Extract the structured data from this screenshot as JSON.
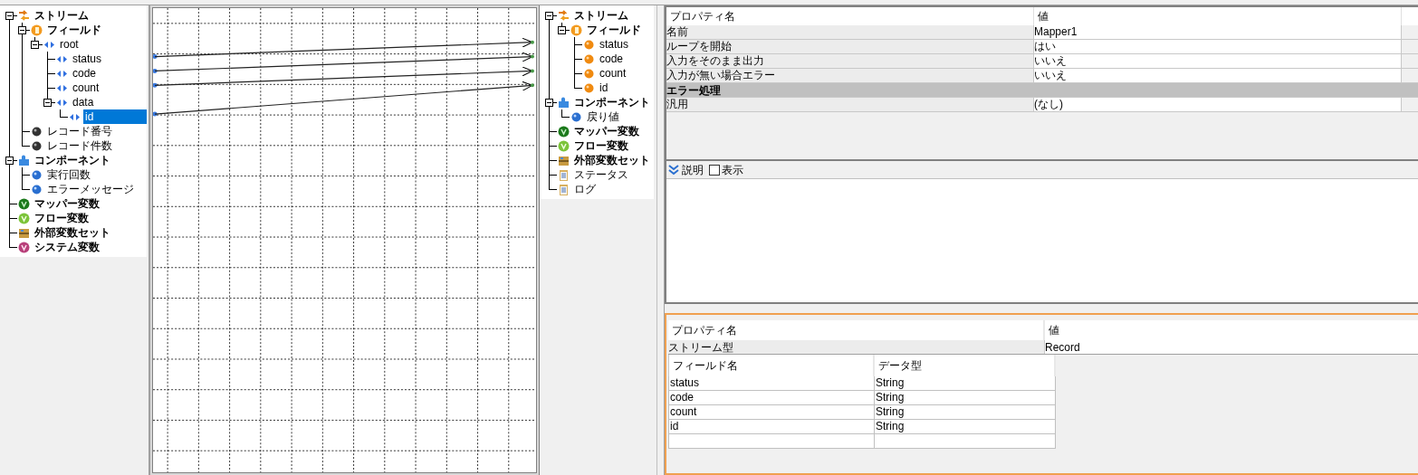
{
  "source_tree": [
    {
      "label": "ストリーム",
      "kind": "stream",
      "bold": true,
      "expanded": true,
      "selected": false,
      "children": [
        {
          "label": "フィールド",
          "kind": "field",
          "bold": true,
          "expanded": true,
          "selected": false,
          "children": [
            {
              "label": "root",
              "kind": "element",
              "bold": false,
              "expanded": true,
              "selected": false,
              "children": [
                {
                  "label": "status",
                  "kind": "element",
                  "bold": false,
                  "selected": false
                },
                {
                  "label": "code",
                  "kind": "element",
                  "bold": false,
                  "selected": false
                },
                {
                  "label": "count",
                  "kind": "element",
                  "bold": false,
                  "selected": false
                },
                {
                  "label": "data",
                  "kind": "element",
                  "bold": false,
                  "expanded": true,
                  "selected": false,
                  "children": [
                    {
                      "label": "id",
                      "kind": "element",
                      "bold": false,
                      "selected": true
                    }
                  ]
                }
              ]
            }
          ]
        },
        {
          "label": "レコード番号",
          "kind": "record",
          "bold": false,
          "selected": false
        },
        {
          "label": "レコード件数",
          "kind": "record",
          "bold": false,
          "selected": false
        }
      ]
    },
    {
      "label": "コンポーネント",
      "kind": "component",
      "bold": true,
      "expanded": true,
      "selected": false,
      "children": [
        {
          "label": "実行回数",
          "kind": "value",
          "bold": false,
          "selected": false
        },
        {
          "label": "エラーメッセージ",
          "kind": "value",
          "bold": false,
          "selected": false
        }
      ]
    },
    {
      "label": "マッパー変数",
      "kind": "mapper",
      "bold": true,
      "selected": false
    },
    {
      "label": "フロー変数",
      "kind": "flow",
      "bold": true,
      "selected": false
    },
    {
      "label": "外部変数セット",
      "kind": "external",
      "bold": true,
      "selected": false
    },
    {
      "label": "システム変数",
      "kind": "system",
      "bold": true,
      "selected": false
    }
  ],
  "target_tree": [
    {
      "label": "ストリーム",
      "kind": "stream",
      "bold": true,
      "expanded": true,
      "selected": false,
      "children": [
        {
          "label": "フィールド",
          "kind": "field",
          "bold": true,
          "expanded": true,
          "selected": false,
          "children": [
            {
              "label": "status",
              "kind": "ball",
              "bold": false,
              "selected": false
            },
            {
              "label": "code",
              "kind": "ball",
              "bold": false,
              "selected": false
            },
            {
              "label": "count",
              "kind": "ball",
              "bold": false,
              "selected": false
            },
            {
              "label": "id",
              "kind": "ball",
              "bold": false,
              "selected": false
            }
          ]
        }
      ]
    },
    {
      "label": "コンポーネント",
      "kind": "component",
      "bold": true,
      "expanded": true,
      "selected": false,
      "children": [
        {
          "label": "戻り値",
          "kind": "value",
          "bold": false,
          "selected": false
        }
      ]
    },
    {
      "label": "マッパー変数",
      "kind": "mapper",
      "bold": true,
      "selected": false
    },
    {
      "label": "フロー変数",
      "kind": "flow",
      "bold": true,
      "selected": false
    },
    {
      "label": "外部変数セット",
      "kind": "external",
      "bold": true,
      "selected": false
    },
    {
      "label": "ステータス",
      "kind": "clipboard",
      "bold": false,
      "selected": false
    },
    {
      "label": "ログ",
      "kind": "clipboard",
      "bold": false,
      "selected": false
    }
  ],
  "properties": {
    "columns": [
      "プロパティ名",
      "値"
    ],
    "rows": [
      {
        "kind": "property",
        "name": "名前",
        "value": "Mapper1"
      },
      {
        "kind": "property",
        "name": "ループを開始",
        "value": "はい"
      },
      {
        "kind": "property",
        "name": "入力をそのまま出力",
        "value": "いいえ"
      },
      {
        "kind": "property",
        "name": "入力が無い場合エラー",
        "value": "いいえ"
      },
      {
        "kind": "section",
        "name": "エラー処理"
      },
      {
        "kind": "property",
        "name": "汎用",
        "value": "(なし)"
      }
    ]
  },
  "description_bar": {
    "label": "説明",
    "show_checkbox": {
      "label": "表示",
      "checked": false
    }
  },
  "stream_properties": {
    "columns": [
      "プロパティ名",
      "値"
    ],
    "rows": [
      {
        "name": "ストリーム型",
        "value": "Record"
      }
    ],
    "field_table": {
      "columns": [
        "フィールド名",
        "データ型"
      ],
      "rows": [
        [
          "status",
          "String"
        ],
        [
          "code",
          "String"
        ],
        [
          "count",
          "String"
        ],
        [
          "id",
          "String"
        ]
      ]
    }
  }
}
